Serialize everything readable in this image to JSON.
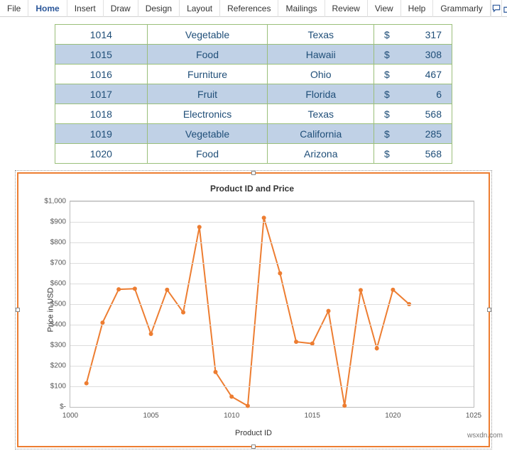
{
  "ribbon": {
    "tabs": [
      "File",
      "Home",
      "Insert",
      "Draw",
      "Design",
      "Layout",
      "References",
      "Mailings",
      "Review",
      "View",
      "Help",
      "Grammarly"
    ],
    "active": 1
  },
  "table": {
    "currency": "$",
    "rows": [
      {
        "id": "1014",
        "category": "Vegetable",
        "state": "Texas",
        "price": "317",
        "band": false
      },
      {
        "id": "1015",
        "category": "Food",
        "state": "Hawaii",
        "price": "308",
        "band": true
      },
      {
        "id": "1016",
        "category": "Furniture",
        "state": "Ohio",
        "price": "467",
        "band": false
      },
      {
        "id": "1017",
        "category": "Fruit",
        "state": "Florida",
        "price": "6",
        "band": true
      },
      {
        "id": "1018",
        "category": "Electronics",
        "state": "Texas",
        "price": "568",
        "band": false
      },
      {
        "id": "1019",
        "category": "Vegetable",
        "state": "California",
        "price": "285",
        "band": true
      },
      {
        "id": "1020",
        "category": "Food",
        "state": "Arizona",
        "price": "568",
        "band": false
      }
    ]
  },
  "chart_data": {
    "type": "line",
    "title": "Product ID and Price",
    "xlabel": "Product  ID",
    "ylabel": "Price in USD",
    "xlim": [
      1000,
      1025
    ],
    "ylim": [
      0,
      1000
    ],
    "yticks": [
      "$-",
      "$100",
      "$200",
      "$300",
      "$400",
      "$500",
      "$600",
      "$700",
      "$800",
      "$900",
      "$1,000"
    ],
    "xticks": [
      "1000",
      "1005",
      "1010",
      "1015",
      "1020",
      "1025"
    ],
    "series": [
      {
        "name": "Price",
        "x": [
          1001,
          1002,
          1003,
          1004,
          1005,
          1006,
          1007,
          1008,
          1009,
          1010,
          1011,
          1012,
          1013,
          1014,
          1015,
          1016,
          1017,
          1018,
          1019,
          1020,
          1021
        ],
        "values": [
          115,
          410,
          572,
          575,
          355,
          570,
          460,
          875,
          170,
          50,
          5,
          920,
          650,
          317,
          308,
          467,
          6,
          568,
          285,
          570,
          500
        ]
      }
    ],
    "color": "#ed7d31"
  },
  "footer_note": "wsxdn.com"
}
